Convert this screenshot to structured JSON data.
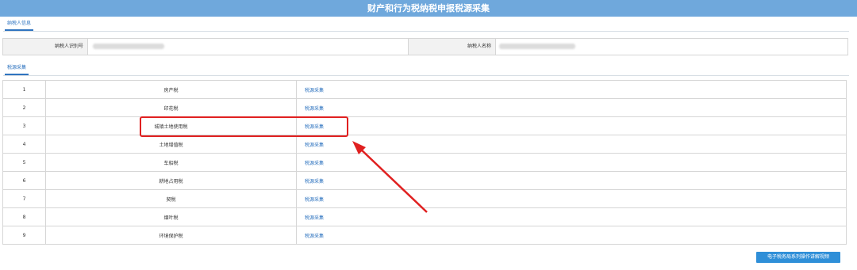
{
  "title": "财产和行为税纳税申报税源采集",
  "taxpayer_tab": "纳税人信息",
  "taxpayer_id_label": "纳税人识别号",
  "taxpayer_name_label": "纳税人名称",
  "source_tab": "税源采集",
  "rows": [
    {
      "num": "1",
      "name": "房产税",
      "link": "税源采集"
    },
    {
      "num": "2",
      "name": "印花税",
      "link": "税源采集"
    },
    {
      "num": "3",
      "name": "城镇土地使用税",
      "link": "税源采集"
    },
    {
      "num": "4",
      "name": "土地增值税",
      "link": "税源采集"
    },
    {
      "num": "5",
      "name": "车船税",
      "link": "税源采集"
    },
    {
      "num": "6",
      "name": "耕地占用税",
      "link": "税源采集"
    },
    {
      "num": "7",
      "name": "契税",
      "link": "税源采集"
    },
    {
      "num": "8",
      "name": "烟叶税",
      "link": "税源采集"
    },
    {
      "num": "9",
      "name": "环境保护税",
      "link": "税源采集"
    }
  ],
  "guide_button": "电子税务局系列操作讲解视频",
  "colors": {
    "header": "#6fa8dc",
    "accent": "#2f74c0",
    "highlight": "#e02020",
    "button": "#2f8fd8"
  }
}
